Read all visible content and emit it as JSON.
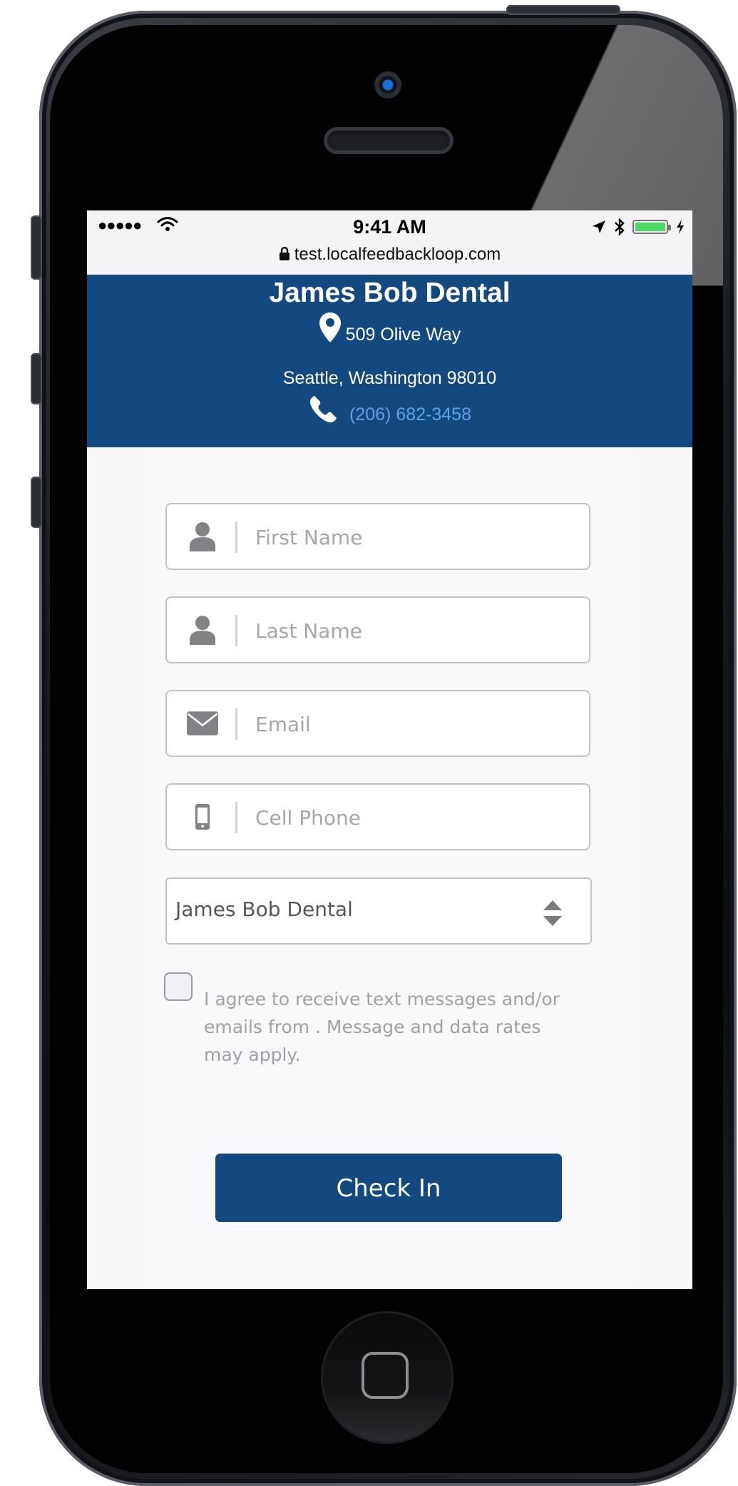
{
  "status_bar": {
    "signal": "●●●●●",
    "time": "9:41 AM",
    "url": "test.localfeedbackloop.com",
    "battery_level": 1.0
  },
  "header": {
    "business_name": "James Bob Dental",
    "address_line1": "509 Olive Way",
    "address_line2": "Seattle, Washington 98010",
    "phone": "(206) 682-3458"
  },
  "form": {
    "first_name": {
      "placeholder": "First Name",
      "icon": "user-icon"
    },
    "last_name": {
      "placeholder": "Last Name",
      "icon": "user-icon"
    },
    "email": {
      "placeholder": "Email",
      "icon": "envelope-icon"
    },
    "cell_phone": {
      "placeholder": "Cell Phone",
      "icon": "mobile-phone-icon"
    },
    "location_select": {
      "value": "James Bob Dental"
    },
    "consent_text": "I agree to receive text messages and/or emails from . Message and data rates may apply.",
    "consent_checked": false,
    "submit_label": "Check In"
  },
  "colors": {
    "brand": "#14497f",
    "link": "#5aa2ea",
    "placeholder": "#a6a6aa"
  }
}
